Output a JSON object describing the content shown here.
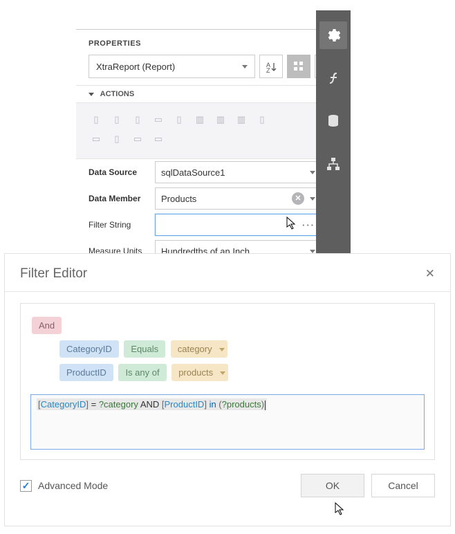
{
  "propsPanel": {
    "header": "PROPERTIES",
    "selector": "XtraReport (Report)",
    "section": "ACTIONS",
    "rows": {
      "dataSource": {
        "label": "Data Source",
        "value": "sqlDataSource1"
      },
      "dataMember": {
        "label": "Data Member",
        "value": "Products"
      },
      "filterString": {
        "label": "Filter String",
        "value": ""
      },
      "measureUnits": {
        "label": "Measure Units",
        "value": "Hundredths of an Inch"
      }
    }
  },
  "filterEditor": {
    "title": "Filter Editor",
    "group": "And",
    "criteria": [
      {
        "field": "CategoryID",
        "op": "Equals",
        "value": "category"
      },
      {
        "field": "ProductID",
        "op": "Is any of",
        "value": "products"
      }
    ],
    "expression": {
      "parts": [
        {
          "t": "pun",
          "v": "["
        },
        {
          "t": "field",
          "v": "CategoryID"
        },
        {
          "t": "pun",
          "v": "]"
        },
        {
          "t": "op",
          "v": " = "
        },
        {
          "t": "num",
          "v": "?category"
        },
        {
          "t": "op",
          "v": " AND "
        },
        {
          "t": "pun",
          "v": "["
        },
        {
          "t": "field",
          "v": "ProductID"
        },
        {
          "t": "pun",
          "v": "]"
        },
        {
          "t": "kw",
          "v": " in "
        },
        {
          "t": "pun",
          "v": "("
        },
        {
          "t": "num",
          "v": "?products"
        },
        {
          "t": "pun",
          "v": ")"
        }
      ]
    },
    "advancedLabel": "Advanced Mode",
    "advancedChecked": true,
    "okLabel": "OK",
    "cancelLabel": "Cancel"
  }
}
